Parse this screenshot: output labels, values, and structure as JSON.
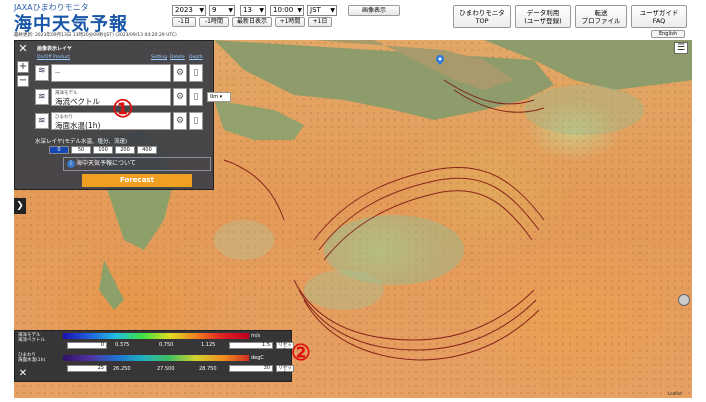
{
  "header": {
    "brand_sub": "JAXAひまわりモニタ",
    "brand_title": "海中天気予報",
    "meta": "最終更新: 2023年09月13日 13時20分09秒(JST) (2023/09/13 04:20:29 UTC)",
    "year": "2023",
    "month": "9",
    "day": "13",
    "time": "10:00",
    "timezone": "JST",
    "nav_buttons": [
      "-1日",
      "-1時間",
      "最新日表示",
      "+1時間",
      "+1日"
    ],
    "image_display": "画像表示",
    "right_buttons": [
      {
        "l1": "ひまわりモニタ",
        "l2": "TOP"
      },
      {
        "l1": "データ利用",
        "l2": "(ユーザ登録)"
      },
      {
        "l1": "転送",
        "l2": "プロファイル"
      },
      {
        "l1": "ユーザガイド",
        "l2": "FAQ"
      }
    ],
    "language": "English"
  },
  "panel": {
    "title": "画像表示レイヤ",
    "hdr_left": "On/Off  Product",
    "hdr_setting": "Setting",
    "hdr_delete": "Delete",
    "hdr_depth": "Depth",
    "rows": [
      {
        "small": "",
        "large": "--"
      },
      {
        "small": "海洋モデル",
        "large": "海流ベクトル",
        "depth": "0m"
      },
      {
        "small": "ひまわり",
        "large": "海面水温(1h)"
      }
    ],
    "depth_label": "水深レイヤ(モデル水温、塩分、流速)",
    "depths": [
      "0",
      "50",
      "100",
      "200",
      "400"
    ],
    "info": "海中天気予報について",
    "forecast": "Forecast"
  },
  "annotations": {
    "a1": "①",
    "a2": "②"
  },
  "legend": {
    "current": {
      "label1": "海洋モデル",
      "label2": "海流ベクトル",
      "unit": "m/s",
      "ticks": [
        "0",
        "0.375",
        "0.750",
        "1.125",
        "1.5"
      ],
      "min": "0",
      "max": "1.5",
      "reset": "リセット"
    },
    "sst": {
      "label1": "ひまわり",
      "label2": "海面水温(1h)",
      "unit": "degC",
      "ticks": [
        "25",
        "26.250",
        "27.500",
        "28.750",
        "30"
      ],
      "min": "25",
      "max": "30",
      "reset": "リセット"
    }
  },
  "map": {
    "credit": "Leaflet"
  },
  "colors": {
    "brand": "#1a57a8",
    "panel_bg": "#373c46",
    "forecast": "#f0a020",
    "depth_active": "#1446b4",
    "annotation": "#dd1111"
  }
}
